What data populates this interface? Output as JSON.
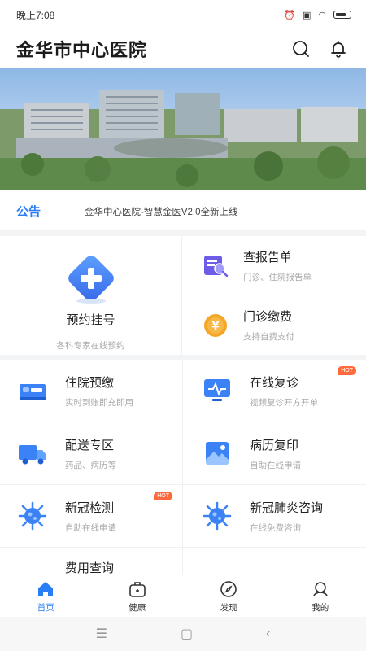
{
  "status": {
    "time": "晚上7:08"
  },
  "header": {
    "title": "金华市中心医院"
  },
  "notice": {
    "label": "公告",
    "text": "金华中心医院-智慧金医V2.0全新上线"
  },
  "appointment": {
    "title": "预约挂号",
    "subtitle": "各科专家在线预约"
  },
  "side_items": [
    {
      "title": "查报告单",
      "subtitle": "门诊、住院报告单",
      "icon": "report-search-icon"
    },
    {
      "title": "门诊缴费",
      "subtitle": "支持自费支付",
      "icon": "yuan-coin-icon"
    }
  ],
  "services": [
    {
      "title": "住院预缴",
      "subtitle": "实时到账即充即用",
      "icon": "hospital-bed-icon",
      "badge": ""
    },
    {
      "title": "在线复诊",
      "subtitle": "视频复诊开方开单",
      "icon": "monitor-pulse-icon",
      "badge": "HOT"
    },
    {
      "title": "配送专区",
      "subtitle": "药品、病历等",
      "icon": "delivery-truck-icon",
      "badge": ""
    },
    {
      "title": "病历复印",
      "subtitle": "自助在线申请",
      "icon": "medical-record-icon",
      "badge": ""
    },
    {
      "title": "新冠检测",
      "subtitle": "自助在线申请",
      "icon": "virus-icon",
      "badge": "HOT"
    },
    {
      "title": "新冠肺炎咨询",
      "subtitle": "在线免费咨询",
      "icon": "virus-icon",
      "badge": ""
    },
    {
      "title": "费用查询",
      "subtitle": "",
      "icon": "cost-query-icon",
      "badge": ""
    }
  ],
  "tabs": [
    {
      "label": "首页",
      "icon": "home-icon",
      "active": true
    },
    {
      "label": "健康",
      "icon": "health-bag-icon",
      "active": false
    },
    {
      "label": "发现",
      "icon": "discover-icon",
      "active": false
    },
    {
      "label": "我的",
      "icon": "profile-icon",
      "active": false
    }
  ],
  "colors": {
    "accent": "#2a7ef5",
    "badge": "#ff6a3d",
    "orange": "#f5a623"
  }
}
